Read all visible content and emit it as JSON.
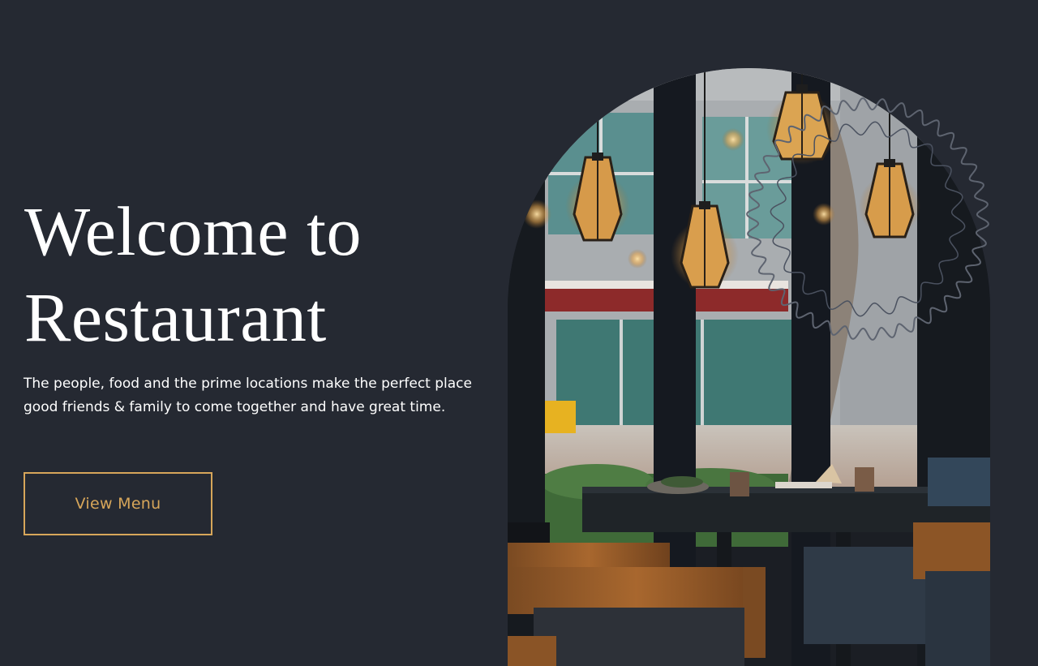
{
  "hero": {
    "title_line1": "Welcome to",
    "title_line2": "Restaurant",
    "subtitle_line1": "The people, food and the prime locations make the perfect place",
    "subtitle_line2": "good friends & family to come together and have great time.",
    "button_label": "View Menu"
  },
  "image": {
    "alt": "Restaurant interior with hanging pendant lamps and a window to the street"
  },
  "colors": {
    "background": "#252932",
    "text": "#ffffff",
    "accent": "#d7a65a"
  }
}
